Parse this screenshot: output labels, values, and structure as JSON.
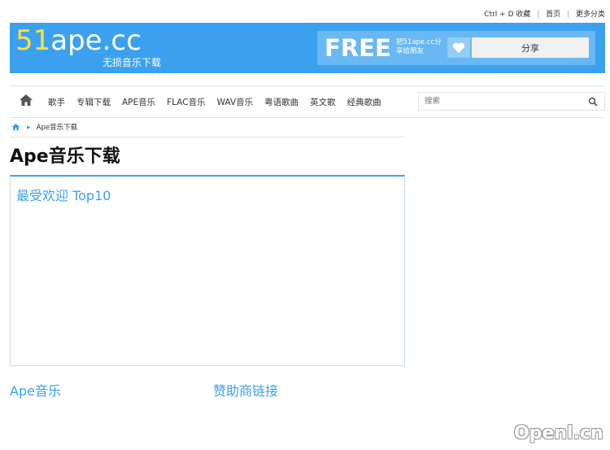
{
  "topbar": {
    "bookmark": "Ctrl + D 收藏",
    "home": "首页",
    "more": "更多分类"
  },
  "header": {
    "logo_num": "51",
    "logo_rest": "ape.cc",
    "logo_sub": "无损音乐下载",
    "free": "FREE",
    "share_desc_line1": "把51ape.cc分",
    "share_desc_line2": "享给朋友",
    "share_button": "分享"
  },
  "nav": {
    "items": [
      "歌手",
      "专辑下载",
      "APE音乐",
      "FLAC音乐",
      "WAV音乐",
      "粤语歌曲",
      "英文歌",
      "经典歌曲"
    ],
    "search_placeholder": "搜索"
  },
  "breadcrumb": {
    "current": "Ape音乐下载"
  },
  "main": {
    "title": "Ape音乐下载",
    "top10_title": "最受欢迎 Top10",
    "section_ape": "Ape音乐",
    "section_sponsor": "赞助商链接"
  },
  "watermark": "Openl.cn",
  "colors": {
    "accent": "#3ba1ee",
    "logo_yellow": "#ffe23b",
    "share_bg": "#69b7f3"
  }
}
